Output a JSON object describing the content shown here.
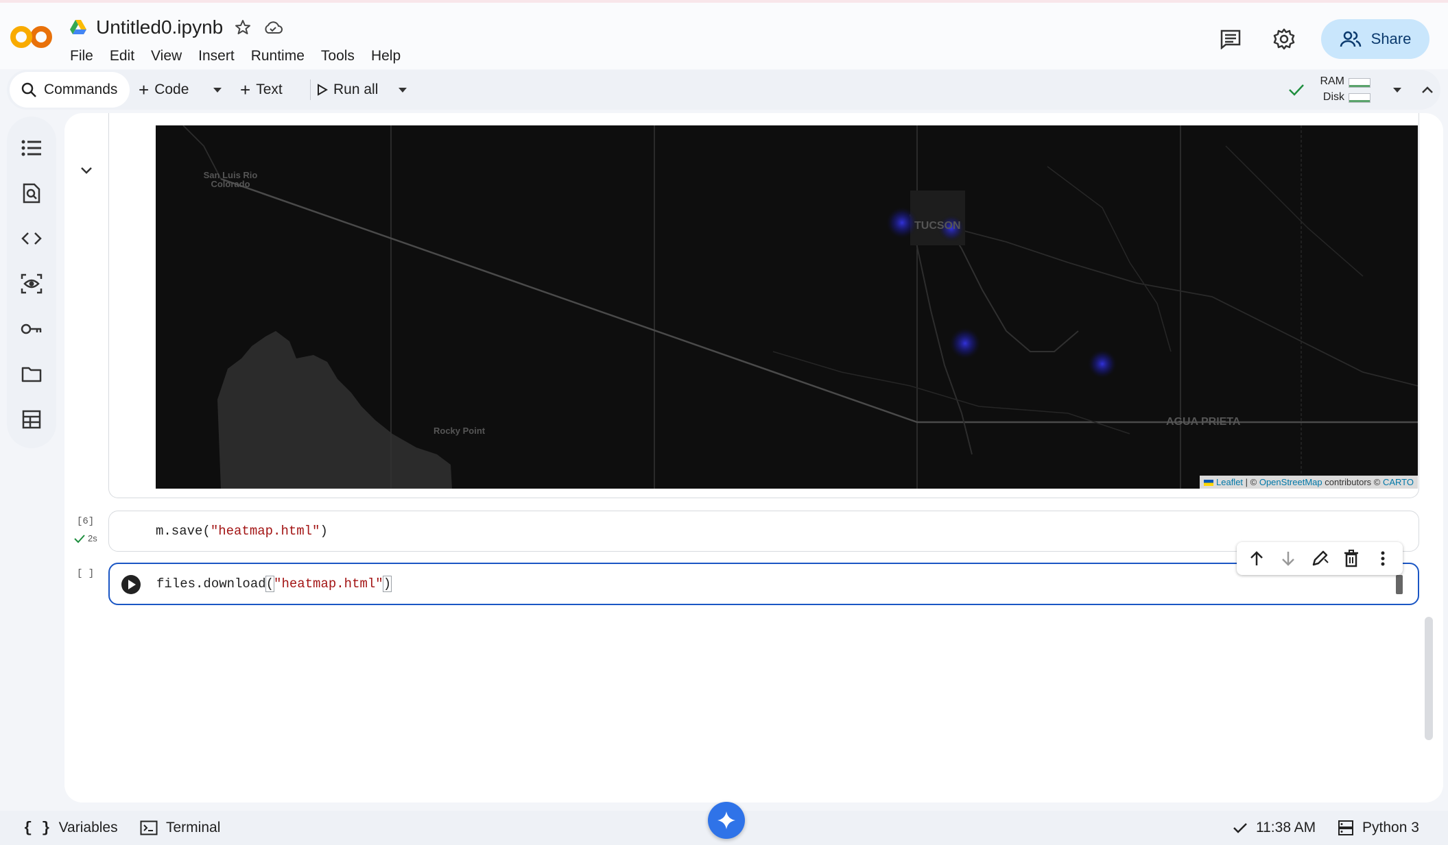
{
  "app": {
    "filename": "Untitled0.ipynb",
    "menu": [
      "File",
      "Edit",
      "View",
      "Insert",
      "Runtime",
      "Tools",
      "Help"
    ],
    "share_label": "Share"
  },
  "toolbar": {
    "commands_label": "Commands",
    "code_label": "Code",
    "text_label": "Text",
    "run_all_label": "Run all",
    "ram_label": "RAM",
    "disk_label": "Disk"
  },
  "map": {
    "labels": {
      "san_luis": "San Luis Rio Colorado",
      "tucson": "TUCSON",
      "rocky_point": "Rocky Point",
      "agua_prieta": "AGUA PRIETA"
    },
    "attribution": {
      "leaflet": "Leaflet",
      "sep": " | © ",
      "osm": "OpenStreetMap",
      "contributors": " contributors © ",
      "carto": "CARTO"
    }
  },
  "cells": [
    {
      "exec_count": "[6]",
      "status_time": "2s",
      "code_prefix": "m.save(",
      "code_string": "\"heatmap.html\"",
      "code_suffix": ")"
    },
    {
      "exec_count": "[ ]",
      "code_prefix": "files.download",
      "code_open": "(",
      "code_string": "\"heatmap.html\"",
      "code_close": ")"
    }
  ],
  "statusbar": {
    "variables_label": "Variables",
    "terminal_label": "Terminal",
    "time": "11:38 AM",
    "runtime_label": "Python 3"
  },
  "colors": {
    "accent_blue": "#1a56c4",
    "share_bg": "#c9e6fc",
    "heat_blue": "#2b2bff",
    "check_green": "#1e8e3e"
  }
}
